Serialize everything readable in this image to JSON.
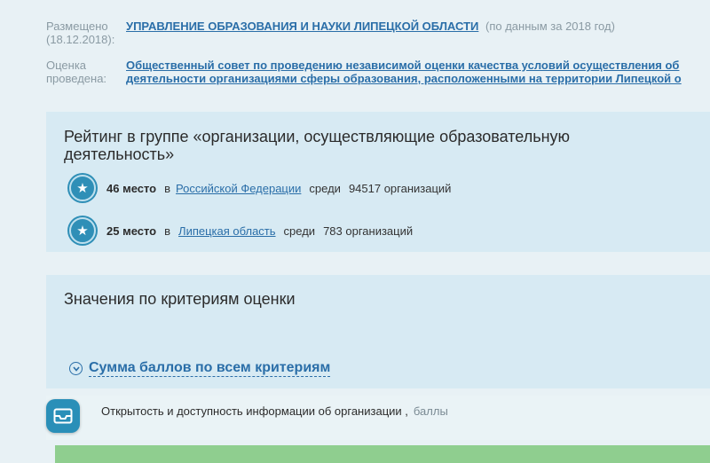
{
  "meta": {
    "posted_label": "Размещено (18.12.2018):",
    "org_name": "УПРАВЛЕНИЕ ОБРАЗОВАНИЯ И НАУКИ ЛИПЕЦКОЙ ОБЛАСТИ",
    "org_note": "(по данным за 2018 год)",
    "assessed_label": "Оценка проведена:",
    "council_line1": "Общественный совет по проведению независимой оценки качества условий осуществления об",
    "council_line2": "деятельности организациями сферы образования, расположенными на территории Липецкой о"
  },
  "rating": {
    "title": "Рейтинг в группе «организации, осуществляющие образовательную деятельность»",
    "rows": [
      {
        "place": "46 место",
        "in_word": "в",
        "region": "Российской Федерации",
        "among_word": "среди",
        "count": "94517 организаций"
      },
      {
        "place": "25 место",
        "in_word": "в",
        "region": "Липецкая область",
        "among_word": "среди",
        "count": "783 организаций"
      }
    ]
  },
  "criteria": {
    "title": "Значения по критериям оценки",
    "sum_label": "Сумма баллов по всем критериям",
    "item_text": "Открытость и доступность информации об организации ,",
    "item_unit": "баллы"
  },
  "icons": {
    "rank": "star-icon",
    "toggle": "chevron-down-icon",
    "criteria": "inbox-tray-icon"
  },
  "colors": {
    "accent": "#2a6ea8",
    "badge": "#2f8fb7",
    "panel": "#d7eaf3",
    "progress": "#8fce8f"
  }
}
